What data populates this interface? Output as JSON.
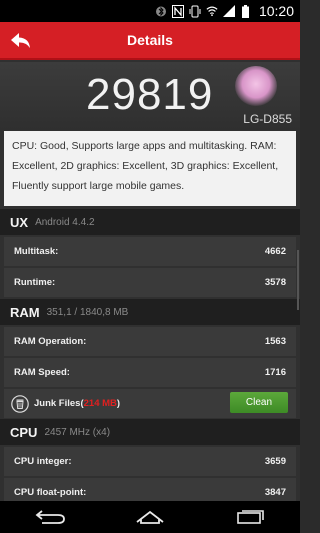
{
  "status_bar": {
    "time": "10:20",
    "icons": [
      "bluetooth-icon",
      "nfc-icon",
      "vibrate-icon",
      "wifi-icon",
      "signal-icon",
      "battery-icon"
    ]
  },
  "header": {
    "title": "Details",
    "back_icon": "back-arrow-icon"
  },
  "score": {
    "value": "29819",
    "device": "LG-D855"
  },
  "summary": "CPU: Good, Supports large apps and multitasking. RAM: Excellent, 2D graphics: Excellent, 3D graphics: Excellent, Fluently support large mobile games.",
  "sections": {
    "ux": {
      "name": "UX",
      "subtitle": "Android 4.4.2",
      "rows": [
        {
          "label": "Multitask:",
          "value": "4662"
        },
        {
          "label": "Runtime:",
          "value": "3578"
        }
      ]
    },
    "ram": {
      "name": "RAM",
      "subtitle": "351,1 / 1840,8 MB",
      "rows": [
        {
          "label": "RAM Operation:",
          "value": "1563"
        },
        {
          "label": "RAM Speed:",
          "value": "1716"
        }
      ],
      "junk": {
        "label": "Junk Files(",
        "size": "214 MB",
        "close": ")",
        "button": "Clean"
      }
    },
    "cpu": {
      "name": "CPU",
      "subtitle": "2457 MHz (x4)",
      "rows": [
        {
          "label": "CPU integer:",
          "value": "3659"
        },
        {
          "label": "CPU float-point:",
          "value": "3847"
        }
      ]
    }
  },
  "colors": {
    "accent": "#d51f25",
    "clean_button": "#4a9a2e",
    "junk_size": "#e02020"
  }
}
